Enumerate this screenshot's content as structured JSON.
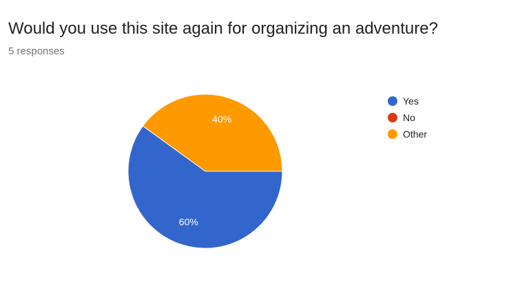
{
  "question": {
    "title": "Would you use this site again for organizing an adventure?",
    "responses_text": "5 responses"
  },
  "chart_data": {
    "type": "pie",
    "categories": [
      "Yes",
      "No",
      "Other"
    ],
    "values": [
      60,
      0,
      40
    ],
    "value_labels": [
      "60%",
      "",
      "40%"
    ],
    "colors": [
      "#3366cc",
      "#dc3912",
      "#ff9900"
    ],
    "legend_position": "right"
  }
}
